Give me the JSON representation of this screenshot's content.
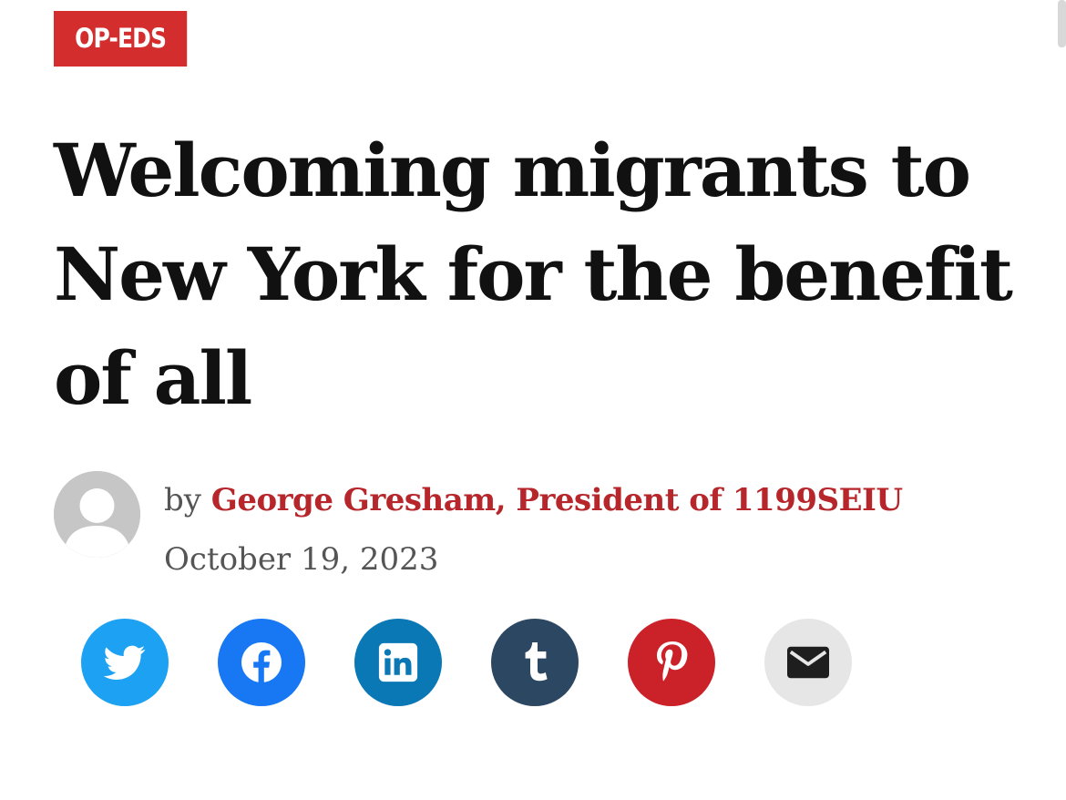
{
  "article": {
    "category": "OP-EDS",
    "headline": "Welcoming migrants to New York for the benefit of all",
    "byline_prefix": "by",
    "author": "George Gresham, President of 1199SEIU",
    "date": "October 19, 2023"
  },
  "share_buttons": [
    {
      "icon": "twitter-icon",
      "color": "#1da1f2"
    },
    {
      "icon": "facebook-icon",
      "color": "#1877f2"
    },
    {
      "icon": "linkedin-icon",
      "color": "#0a78b5"
    },
    {
      "icon": "tumblr-icon",
      "color": "#2c4762"
    },
    {
      "icon": "pinterest-icon",
      "color": "#cb2128"
    },
    {
      "icon": "email-icon",
      "color": "#e6e6e6"
    }
  ],
  "colors": {
    "accent": "#d42d2d",
    "author_link": "#b6262b",
    "headline_text": "#111111",
    "meta_text": "#555555"
  }
}
